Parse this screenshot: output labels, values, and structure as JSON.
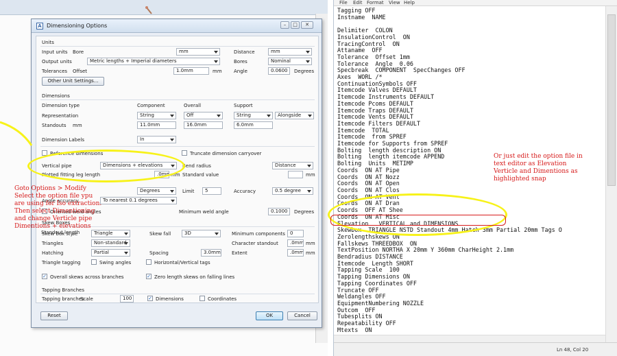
{
  "dialog": {
    "title": "Dimensioning Options",
    "units": {
      "section": "Units",
      "input_units_label": "Input units",
      "bore_label": "Bore",
      "bore_value": "mm",
      "distance_label": "Distance",
      "distance_value": "mm",
      "output_units_label": "Output units",
      "output_units_value": "Metric lengths + Imperial diameters",
      "bores_label": "Bores",
      "bores_value": "Nominal",
      "tolerances_label": "Tolerances",
      "offset_label": "Offset",
      "offset_value": "1.0mm",
      "offset_unit": "mm",
      "angle_label": "Angle",
      "angle_value": "0.0600",
      "angle_unit": "Degrees",
      "other_unit_button": "Other Unit Settings..."
    },
    "dimensions": {
      "section": "Dimensions",
      "col_type": "Dimension type",
      "col_component": "Component",
      "col_overall": "Overall",
      "col_support": "Support",
      "representation_label": "Representation",
      "rep_component": "String",
      "rep_overall": "Off",
      "rep_support": "String",
      "rep_alongside": "Alongside",
      "standouts_label": "Standouts",
      "standouts_unit": "mm",
      "standout_component": "11.0mm",
      "standout_overall": "16.0mm",
      "standout_support": "6.0mm",
      "dimension_labels_label": "Dimension Labels",
      "dimension_labels_value": "In",
      "reference_dimensions": "Reference dimensions",
      "truncate_carryover": "Truncate dimension carryover",
      "vertical_pipe_label": "Vertical pipe",
      "vertical_pipe_value": "Dimensions + elevations",
      "bend_radius_label": "Bend radius",
      "bend_radius_value": "Distance",
      "plotted_fitting_label": "Plotted fitting leg length",
      "plotted_fitting_value": ".0mm",
      "plotted_fitting_unit": "mm",
      "standard_value_label": "Standard value",
      "standard_value_unit": "mm",
      "fitting_angle_unit": "Degrees",
      "limit_label": "Limit",
      "limit_value": "5",
      "accuracy_label": "Accuracy",
      "accuracy_value": "0.5 degree",
      "angle_accuracy_label": "Angle accuracy",
      "angle_accuracy_value": "To nearest 0.1 degrees",
      "oriented_weld_angles": "Oriented weld angles",
      "min_weld_angle_label": "Minimum weld angle",
      "min_weld_angle_value": "0.1000",
      "min_weld_angle_unit": "Degrees"
    },
    "skews": {
      "section": "Skew Boxes",
      "skew_label": "Skew box style",
      "skew_value": "Triangle",
      "skew_fall_label": "Skew fall",
      "skew_fall_value": "3D",
      "min_components_label": "Minimum components",
      "min_components_value": "0",
      "triangles_label": "Triangles",
      "triangles_value": "Non-standard",
      "char_standout_label": "Character standout",
      "char_standout_value": ".0mm",
      "char_standout_unit": "mm",
      "hatching_label": "Hatching",
      "hatching_value": "Partial",
      "spacing_label": "Spacing",
      "spacing_value": "3.0mm",
      "extent_label": "Extent",
      "extent_value": ".0mm",
      "extent_unit": "mm",
      "triangle_tagging_label": "Triangle tagging",
      "swing_angles": "Swing angles",
      "horizontal_vertical_tags": "Horizontal/Vertical tags",
      "overall_skews": "Overall skews across branches",
      "zero_length_skews": "Zero length skews on falling lines"
    },
    "tapping": {
      "section": "Tapping Branches",
      "branches_label": "Tapping branches",
      "scale_label": "Scale",
      "scale_value": "100",
      "dimensions_check": "Dimensions",
      "coordinates_check": "Coordinates"
    },
    "buttons": {
      "reset": "Reset",
      "ok": "OK",
      "cancel": "Cancel"
    }
  },
  "annotations": {
    "left_note": [
      "Goto Options > Modify",
      "Select the option file ypu",
      "are using for Iso extraction.",
      "Then select Dimentioning",
      "and change Verticle pipe",
      "Dimentions + elevations"
    ],
    "left_overlap": "Standout length",
    "right_note": [
      "Or just edit the option file in",
      "text editor as Elevation",
      "Verticle and Dimentions as",
      "highlighted snap"
    ]
  },
  "notepad": {
    "menu": [
      "File",
      "Edit",
      "Format",
      "View",
      "Help"
    ],
    "lines": [
      "Tagging OFF",
      "Instname  NAME",
      "",
      "Delimiter  COLON",
      "InsulationControl  ON",
      "TracingControl  ON",
      "Attaname  OFF",
      "Tolerance  Offset 1mm",
      "Tolerance  Angle  0.06",
      "Specbreak  COMPONENT  SpecChanges OFF",
      "Axes  WORL /*",
      "ContinuationSymbols OFF",
      "Itemcode Valves DEFAULT",
      "Itemcode Instruments DEFAULT",
      "Itemcode Pcoms DEFAULT",
      "Itemcode Traps DEFAULT",
      "Itemcode Vents DEFAULT",
      "Itemcode Filters DEFAULT",
      "Itemcode  TOTAL",
      "Itemcode  from SPREF",
      "Itemcode for Supports from SPREF",
      "Bolting  length description ON",
      "Bolting  length itemcode APPEND",
      "Bolting  Units  METIMP",
      "Coords  ON AT Pipe",
      "Coords  ON AT Nozz",
      "Coords  ON AT Open",
      "Coords  ON AT Clos",
      "Coords  ON AT Vent",
      "Coords  ON AT Dran",
      "Coords  OFF AT Shee",
      "Coords  ON AT Misc",
      "Elevation   VERTICAL and DIMENSIONS",
      "Skewbox  TRIANGLE NSTD Standout 4mm Hatch 3mm Partial 20mm Tags O",
      "Zerolengthskews ON",
      "Fallskews THREEDBOX  ON",
      "TextPosition NORTHA X 20mm Y 360mm CharHeight 2.1mm",
      "Bendradius DISTANCE",
      "Itemcode  Length SHORT",
      "Tapping Scale  100",
      "Tapping Dimensions ON",
      "Tapping Coordinates OFF",
      "Truncate OFF",
      "Weldangles OFF",
      "EquipmentNumbering NOZZLE",
      "Outcom  OFF",
      "Tubesplits ON",
      "Repeatability OFF",
      "Mtexts  ON"
    ],
    "status": "Ln 48, Col 20"
  },
  "colors": {
    "annotation_red": "#d61a1a",
    "highlight_yellow": "#f7f219"
  }
}
